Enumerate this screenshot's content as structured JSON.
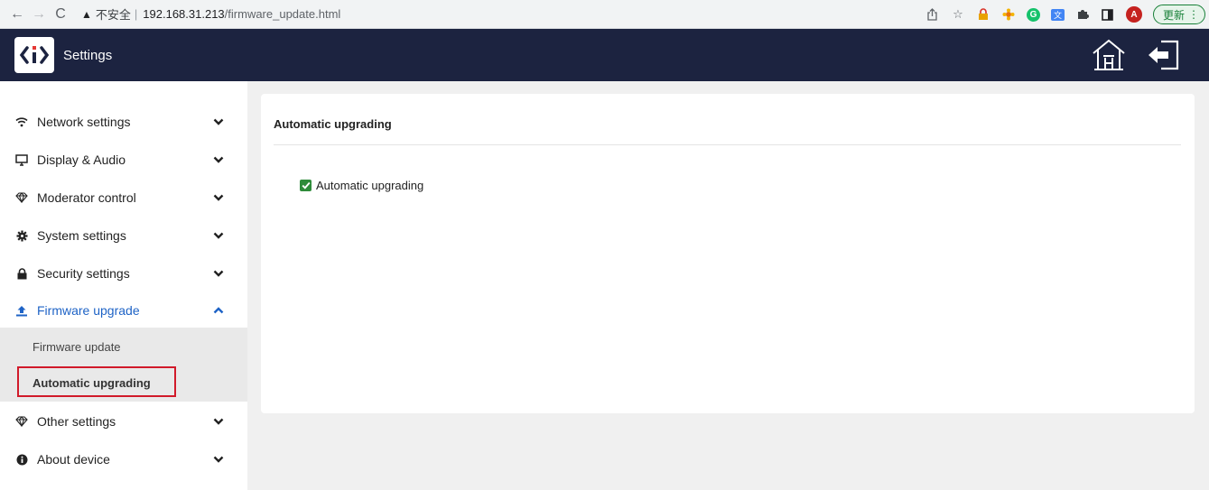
{
  "browser": {
    "back": "←",
    "forward": "→",
    "reload": "C",
    "security_warning": "▲",
    "security_label": "不安全",
    "separator": "|",
    "url_host": "192.168.31.213",
    "url_path": "/firmware_update.html",
    "avatar_letter": "A",
    "update_label": "更新",
    "menu_glyph": "⋮"
  },
  "app": {
    "title": "Settings"
  },
  "sidebar": {
    "items": [
      {
        "label": "Network settings",
        "icon": "wifi-icon",
        "expanded": false
      },
      {
        "label": "Display & Audio",
        "icon": "monitor-icon",
        "expanded": false
      },
      {
        "label": "Moderator control",
        "icon": "diamond-icon",
        "expanded": false
      },
      {
        "label": "System settings",
        "icon": "gear-icon",
        "expanded": false
      },
      {
        "label": "Security settings",
        "icon": "lock-icon",
        "expanded": false
      },
      {
        "label": "Firmware upgrade",
        "icon": "upload-icon",
        "expanded": true
      },
      {
        "label": "Other settings",
        "icon": "diamond-icon",
        "expanded": false
      },
      {
        "label": "About device",
        "icon": "info-icon",
        "expanded": false
      }
    ],
    "submenu": [
      {
        "label": "Firmware update",
        "selected": false
      },
      {
        "label": "Automatic upgrading",
        "selected": true
      }
    ]
  },
  "main": {
    "panel_title": "Automatic upgrading",
    "checkbox_label": "Automatic upgrading",
    "checkbox_checked": true
  },
  "colors": {
    "header_bg": "#1c2340",
    "active_link": "#1e63c6",
    "highlight_border": "#d11a2a",
    "checkbox": "#2e8b3a"
  }
}
